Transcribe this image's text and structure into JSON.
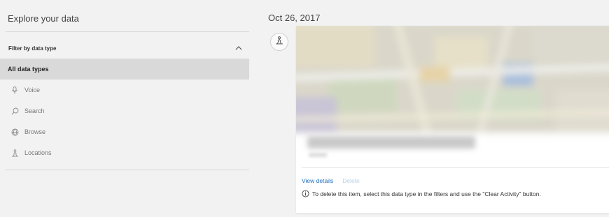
{
  "sidebar": {
    "title": "Explore your data",
    "filter_header": "Filter by data type",
    "items": [
      {
        "label": "All data types",
        "icon": "none"
      },
      {
        "label": "Voice",
        "icon": "microphone-icon"
      },
      {
        "label": "Search",
        "icon": "search-icon"
      },
      {
        "label": "Browse",
        "icon": "globe-icon"
      },
      {
        "label": "Locations",
        "icon": "location-person-icon"
      }
    ]
  },
  "main": {
    "date": "Oct 26, 2017",
    "card": {
      "view_details_label": "View details",
      "delete_label": "Delete",
      "info_text": "To delete this item, select this data type in the filters and use the \"Clear Activity\" button."
    }
  },
  "colors": {
    "link": "#1b6ec2",
    "link_disabled": "#b8cfe8",
    "selected_row": "#d9d9d9",
    "background": "#f2f2f2"
  }
}
